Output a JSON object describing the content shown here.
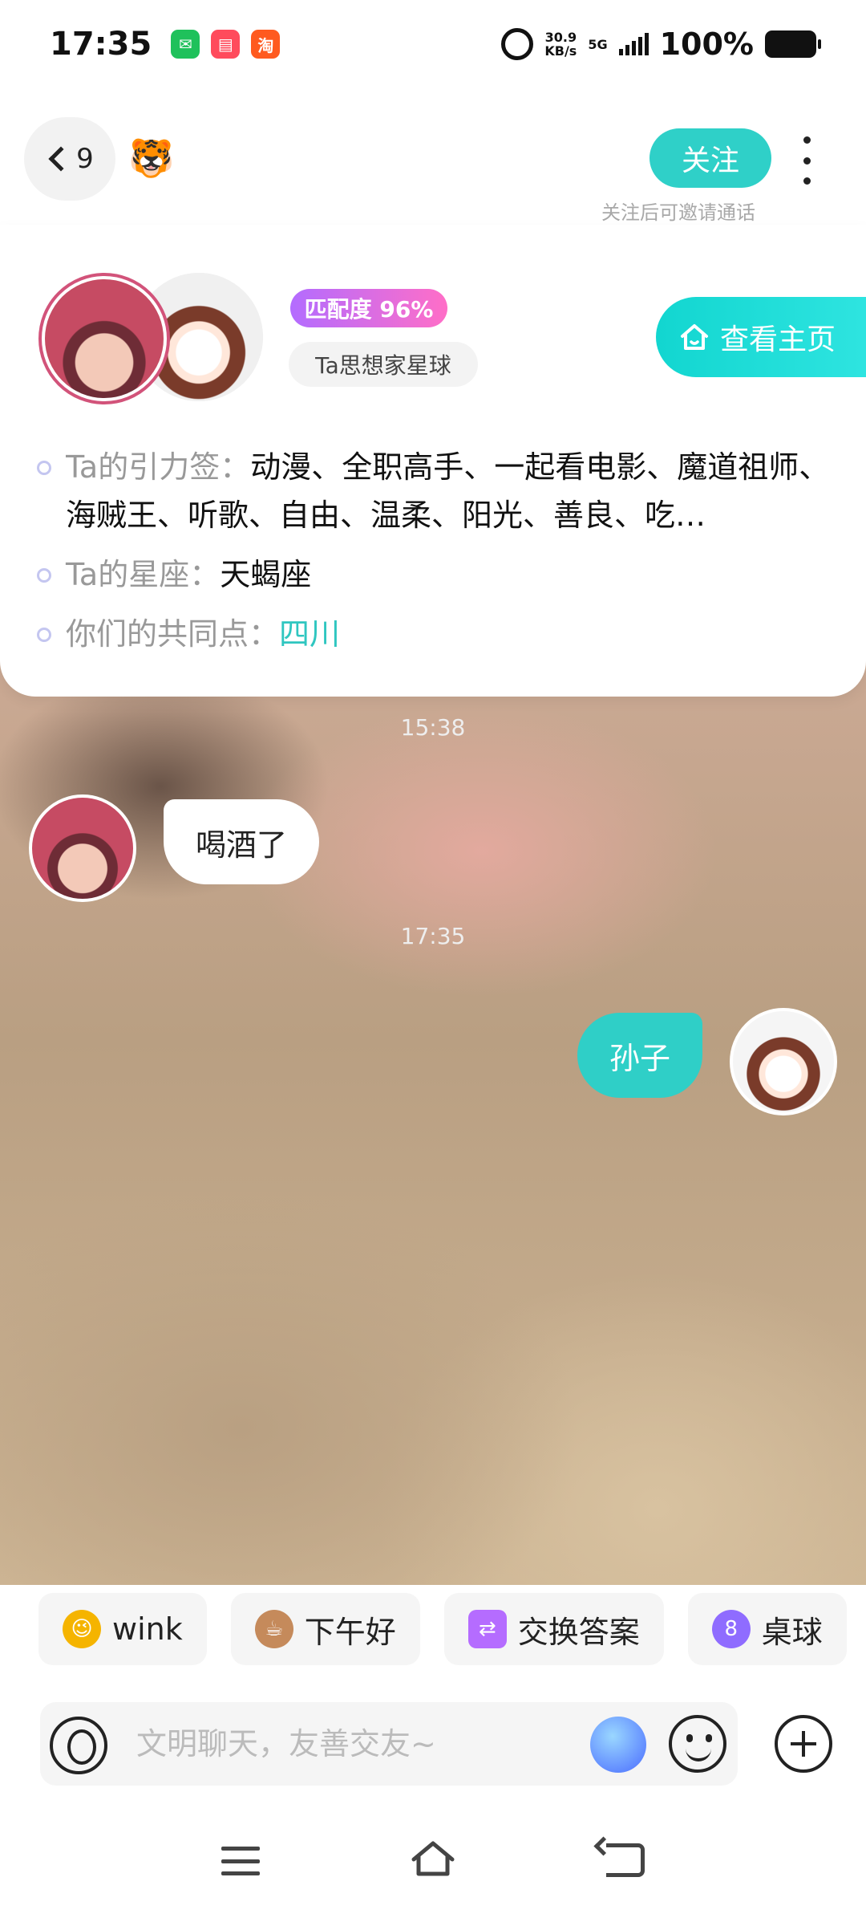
{
  "status_bar": {
    "time": "17:35",
    "net_speed_value": "30.9",
    "net_speed_unit": "KB/s",
    "network": "5G",
    "battery": "100%"
  },
  "header": {
    "back_count": "9",
    "tiger_emoji": "🐯",
    "follow_label": "关注",
    "follow_hint": "关注后可邀请通话"
  },
  "profile": {
    "match_badge": "匹配度 96%",
    "planet_tag": "Ta思想家星球",
    "home_button": "查看主页",
    "info": [
      {
        "label": "Ta的引力签：",
        "value": "动漫、全职高手、一起看电影、魔道祖师、海贼王、听歌、自由、温柔、阳光、善良、吃…"
      },
      {
        "label": "Ta的星座：",
        "value": "天蝎座"
      },
      {
        "label": "你们的共同点：",
        "value": "四川"
      }
    ]
  },
  "messages": {
    "time_1": "15:38",
    "msg_1": "喝酒了",
    "time_2": "17:35",
    "msg_2": "孙子"
  },
  "quick_chips": [
    {
      "icon": "😉",
      "label": "wink",
      "color": "#f5b400"
    },
    {
      "icon": "☕",
      "label": "下午好",
      "color": "#c58a5b"
    },
    {
      "icon": "⇄",
      "label": "交换答案",
      "color": "#b56cff"
    },
    {
      "icon": "8",
      "label": "桌球",
      "color": "#8f6cff"
    }
  ],
  "input": {
    "placeholder": "文明聊天，友善交友~"
  },
  "colors": {
    "accent": "#2fcfc7",
    "match_gradient_start": "#b36cff",
    "match_gradient_end": "#ff6ec7"
  }
}
